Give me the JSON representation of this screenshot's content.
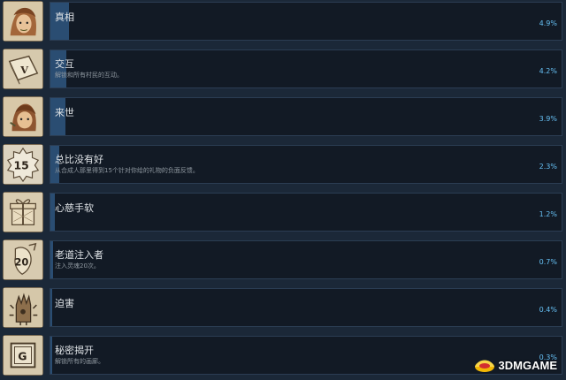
{
  "achievements": [
    {
      "title": "真相",
      "description": "",
      "percent": "4.9%",
      "percent_value": 4.9,
      "icon": "portrait-icon"
    },
    {
      "title": "交互",
      "description": "解锁和所有村民的互动。",
      "percent": "4.2%",
      "percent_value": 4.2,
      "icon": "book-icon"
    },
    {
      "title": "来世",
      "description": "",
      "percent": "3.9%",
      "percent_value": 3.9,
      "icon": "portrait-icon"
    },
    {
      "title": "总比没有好",
      "description": "从合成人那里得到15个针对你给的礼物的负面反馈。",
      "percent": "2.3%",
      "percent_value": 2.3,
      "icon": "badge-15-icon"
    },
    {
      "title": "心慈手软",
      "description": "",
      "percent": "1.2%",
      "percent_value": 1.2,
      "icon": "gift-box-icon"
    },
    {
      "title": "老道注入者",
      "description": "注入灵魂20次。",
      "percent": "0.7%",
      "percent_value": 0.7,
      "icon": "badge-20-icon"
    },
    {
      "title": "迫害",
      "description": "",
      "percent": "0.4%",
      "percent_value": 0.4,
      "icon": "spiked-hand-icon"
    },
    {
      "title": "秘密揭开",
      "description": "解锁所有的画廊。",
      "percent": "0.3%",
      "percent_value": 0.3,
      "icon": "gallery-g-icon"
    }
  ],
  "watermark": {
    "text": "3DMGAME"
  },
  "colors": {
    "bar": "#2a4d72",
    "percent": "#66c0f4",
    "panel": "#121a25",
    "background": "#1b2838"
  }
}
